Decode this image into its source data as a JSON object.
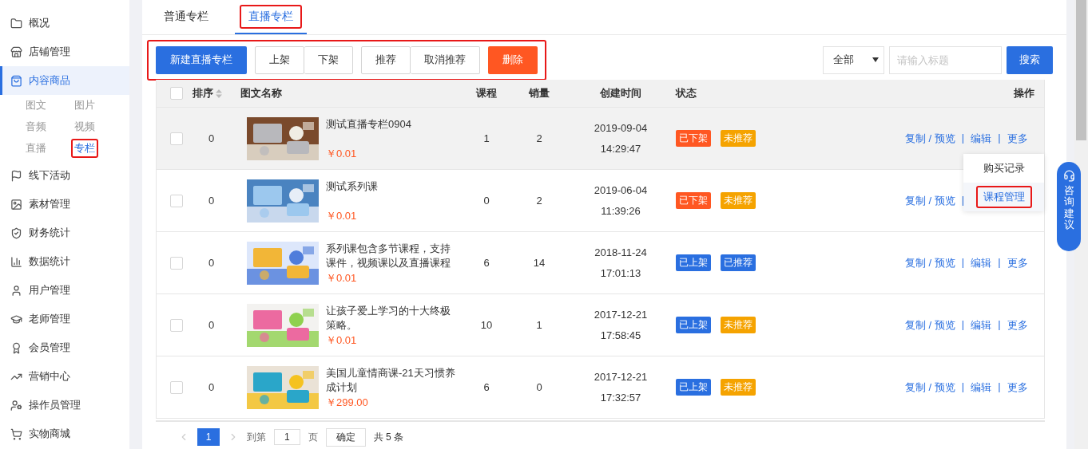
{
  "sidebar": {
    "items": [
      {
        "label": "概况",
        "selected": false
      },
      {
        "label": "店铺管理",
        "selected": false
      },
      {
        "label": "内容商品",
        "selected": true,
        "children": [
          {
            "label": "图文",
            "selected": false,
            "highlighted": false
          },
          {
            "label": "图片",
            "selected": false,
            "highlighted": false
          },
          {
            "label": "音频",
            "selected": false,
            "highlighted": false
          },
          {
            "label": "视频",
            "selected": false,
            "highlighted": false
          },
          {
            "label": "直播",
            "selected": false,
            "highlighted": false
          },
          {
            "label": "专栏",
            "selected": true,
            "highlighted": true
          }
        ]
      },
      {
        "label": "线下活动",
        "selected": false
      },
      {
        "label": "素材管理",
        "selected": false
      },
      {
        "label": "财务统计",
        "selected": false
      },
      {
        "label": "数据统计",
        "selected": false
      },
      {
        "label": "用户管理",
        "selected": false
      },
      {
        "label": "老师管理",
        "selected": false
      },
      {
        "label": "会员管理",
        "selected": false
      },
      {
        "label": "营销中心",
        "selected": false
      },
      {
        "label": "操作员管理",
        "selected": false
      },
      {
        "label": "实物商城",
        "selected": false
      }
    ]
  },
  "tabs": [
    {
      "label": "普通专栏",
      "selected": false,
      "highlighted": false
    },
    {
      "label": "直播专栏",
      "selected": true,
      "highlighted": true
    }
  ],
  "toolbar": {
    "highlighted": true,
    "groups": [
      [
        {
          "label": "新建直播专栏",
          "kind": "primary"
        }
      ],
      [
        {
          "label": "上架",
          "kind": "plain"
        },
        {
          "label": "下架",
          "kind": "plain"
        }
      ],
      [
        {
          "label": "推荐",
          "kind": "plain"
        },
        {
          "label": "取消推荐",
          "kind": "plain"
        }
      ],
      [
        {
          "label": "删除",
          "kind": "danger"
        }
      ]
    ]
  },
  "filter": {
    "select": "全部",
    "placeholder": "请输入标题",
    "search_button": "搜索"
  },
  "table": {
    "all_checked": false,
    "columns": [
      "排序",
      "图文名称",
      "课程",
      "销量",
      "创建时间",
      "状态",
      "操作"
    ],
    "rows": [
      {
        "order": "0",
        "title": "测试直播专栏0904",
        "price": "￥0.01",
        "courses": "1",
        "sales": "2",
        "date": "2019-09-04",
        "time": "14:29:47",
        "hovered": true,
        "checked": false,
        "tags": [
          {
            "label": "已下架",
            "color": "#ff5722"
          },
          {
            "label": "未推荐",
            "color": "#f5a300"
          }
        ],
        "actions": [
          {
            "label": "复制 / 预览",
            "kind": "link"
          },
          {
            "label": "|",
            "kind": "separator"
          },
          {
            "label": "编辑",
            "kind": "link"
          },
          {
            "label": "|",
            "kind": "separator"
          },
          {
            "label": "更多",
            "kind": "link"
          }
        ]
      },
      {
        "order": "0",
        "title": "测试系列课",
        "price": "￥0.01",
        "courses": "0",
        "sales": "2",
        "date": "2019-06-04",
        "time": "11:39:26",
        "hovered": false,
        "checked": false,
        "tags": [
          {
            "label": "已下架",
            "color": "#ff5722"
          },
          {
            "label": "未推荐",
            "color": "#f5a300"
          }
        ],
        "actions": [
          {
            "label": "复制 / 预览",
            "kind": "link"
          },
          {
            "label": "|",
            "kind": "separator"
          }
        ]
      },
      {
        "order": "0",
        "title": "系列课包含多节课程，支持课件，视频课以及直播课程",
        "price": "￥0.01",
        "courses": "6",
        "sales": "14",
        "date": "2018-11-24",
        "time": "17:01:13",
        "hovered": false,
        "checked": false,
        "tags": [
          {
            "label": "已上架",
            "color": "#2a6fe0"
          },
          {
            "label": "已推荐",
            "color": "#2a6fe0"
          }
        ],
        "actions": [
          {
            "label": "复制 / 预览",
            "kind": "link"
          },
          {
            "label": "|",
            "kind": "separator"
          },
          {
            "label": "编辑",
            "kind": "link"
          },
          {
            "label": "|",
            "kind": "separator"
          },
          {
            "label": "更多",
            "kind": "link"
          }
        ]
      },
      {
        "order": "0",
        "title": "让孩子爱上学习的十大终极策略。",
        "price": "￥0.01",
        "courses": "10",
        "sales": "1",
        "date": "2017-12-21",
        "time": "17:58:45",
        "hovered": false,
        "checked": false,
        "tags": [
          {
            "label": "已上架",
            "color": "#2a6fe0"
          },
          {
            "label": "未推荐",
            "color": "#f5a300"
          }
        ],
        "actions": [
          {
            "label": "复制 / 预览",
            "kind": "link"
          },
          {
            "label": "|",
            "kind": "separator"
          },
          {
            "label": "编辑",
            "kind": "link"
          },
          {
            "label": "|",
            "kind": "separator"
          },
          {
            "label": "更多",
            "kind": "link"
          }
        ]
      },
      {
        "order": "0",
        "title": "美国儿童情商课-21天习惯养成计划",
        "price": "￥299.00",
        "courses": "6",
        "sales": "0",
        "date": "2017-12-21",
        "time": "17:32:57",
        "hovered": false,
        "checked": false,
        "tags": [
          {
            "label": "已上架",
            "color": "#2a6fe0"
          },
          {
            "label": "未推荐",
            "color": "#f5a300"
          }
        ],
        "actions": [
          {
            "label": "复制 / 预览",
            "kind": "link"
          },
          {
            "label": "|",
            "kind": "separator"
          },
          {
            "label": "编辑",
            "kind": "link"
          },
          {
            "label": "|",
            "kind": "separator"
          },
          {
            "label": "更多",
            "kind": "link"
          }
        ]
      }
    ]
  },
  "dropdown": {
    "items": [
      {
        "label": "购买记录",
        "selected": false,
        "highlighted": false
      },
      {
        "label": "课程管理",
        "selected": true,
        "highlighted": true
      }
    ]
  },
  "pagination": {
    "current": "1",
    "goto_label": "到第",
    "goto_value": "1",
    "page_label": "页",
    "confirm": "确定",
    "total": "共 5 条"
  },
  "float_button": {
    "label": "咨询建议"
  }
}
